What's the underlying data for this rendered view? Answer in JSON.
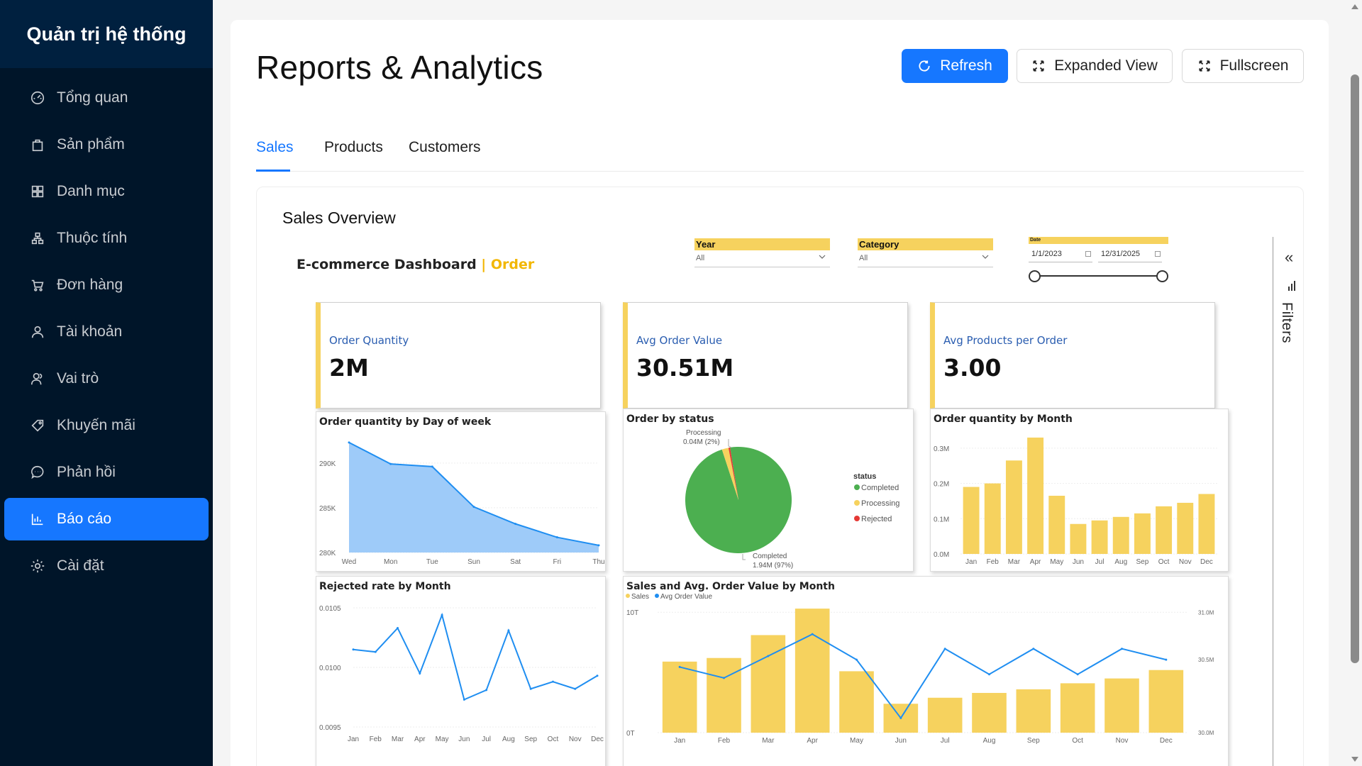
{
  "sidebar": {
    "brand": "Quản trị hệ thống",
    "items": [
      {
        "label": "Tổng quan",
        "icon": "dashboard-icon"
      },
      {
        "label": "Sản phẩm",
        "icon": "shopping-bag-icon"
      },
      {
        "label": "Danh mục",
        "icon": "grid-icon"
      },
      {
        "label": "Thuộc tính",
        "icon": "cluster-icon"
      },
      {
        "label": "Đơn hàng",
        "icon": "cart-icon"
      },
      {
        "label": "Tài khoản",
        "icon": "user-icon"
      },
      {
        "label": "Vai trò",
        "icon": "team-icon"
      },
      {
        "label": "Khuyến mãi",
        "icon": "tag-icon"
      },
      {
        "label": "Phản hồi",
        "icon": "message-icon"
      },
      {
        "label": "Báo cáo",
        "icon": "bar-chart-icon",
        "active": true
      },
      {
        "label": "Cài đặt",
        "icon": "gear-icon"
      }
    ]
  },
  "header": {
    "title": "Reports & Analytics",
    "refresh_label": "Refresh",
    "expanded_label": "Expanded View",
    "fullscreen_label": "Fullscreen"
  },
  "tabs": [
    {
      "label": "Sales",
      "active": true
    },
    {
      "label": "Products"
    },
    {
      "label": "Customers"
    }
  ],
  "overview": {
    "title": "Sales Overview",
    "dashboard_title": "E-commerce Dashboard",
    "dashboard_accent": "| Order",
    "slicers": {
      "year": {
        "label": "Year",
        "value": "All"
      },
      "category": {
        "label": "Category",
        "value": "All"
      },
      "date": {
        "label": "Date",
        "start": "1/1/2023",
        "end": "12/31/2025"
      }
    },
    "kpis": [
      {
        "label": "Order Quantity",
        "value": "2M"
      },
      {
        "label": "Avg Order Value",
        "value": "30.51M"
      },
      {
        "label": "Avg Products per Order",
        "value": "3.00"
      }
    ],
    "filters_label": "Filters",
    "accent_color": "#f6d25e"
  },
  "chart_data": [
    {
      "type": "area",
      "title": "Order quantity by Day of week",
      "categories": [
        "Wed",
        "Mon",
        "Tue",
        "Sun",
        "Sat",
        "Fri",
        "Thu"
      ],
      "values": [
        292300,
        289900,
        289600,
        285100,
        283200,
        281700,
        280800
      ],
      "ylim": [
        280000,
        293000
      ],
      "yticks": [
        "280K",
        "285K",
        "290K"
      ],
      "ytick_values": [
        280000,
        285000,
        290000
      ],
      "color": "#1f8ef1"
    },
    {
      "type": "pie",
      "title": "Order by status",
      "legend_title": "status",
      "legend": [
        "Completed",
        "Processing",
        "Rejected"
      ],
      "values": [
        1.94,
        0.04,
        0.01
      ],
      "colors": [
        "#4caf50",
        "#f6d25e",
        "#e53935"
      ],
      "labels": [
        {
          "line1": "Processing",
          "line2": "0.04M (2%)"
        },
        {
          "line1": "Completed",
          "line2": "1.94M (97%)"
        }
      ]
    },
    {
      "type": "bar",
      "title": "Order quantity by Month",
      "categories": [
        "Jan",
        "Feb",
        "Mar",
        "Apr",
        "May",
        "Jun",
        "Jul",
        "Aug",
        "Sep",
        "Oct",
        "Nov",
        "Dec"
      ],
      "values": [
        0.19,
        0.2,
        0.265,
        0.33,
        0.165,
        0.085,
        0.095,
        0.105,
        0.115,
        0.135,
        0.145,
        0.17
      ],
      "ylim": [
        0,
        0.35
      ],
      "yticks": [
        "0.0M",
        "0.1M",
        "0.2M",
        "0.3M"
      ],
      "ytick_values": [
        0,
        0.1,
        0.2,
        0.3
      ],
      "color": "#f6d25e"
    },
    {
      "type": "line",
      "title": "Rejected rate by Month",
      "categories": [
        "Jan",
        "Feb",
        "Mar",
        "Apr",
        "May",
        "Jun",
        "Jul",
        "Aug",
        "Sep",
        "Oct",
        "Nov",
        "Dec"
      ],
      "values": [
        0.01015,
        0.01013,
        0.01033,
        0.00995,
        0.01044,
        0.00973,
        0.00981,
        0.01031,
        0.00982,
        0.00988,
        0.00982,
        0.00993
      ],
      "ylim": [
        0.0095,
        0.0105
      ],
      "yticks": [
        "0.0095",
        "0.0100",
        "0.0105"
      ],
      "ytick_values": [
        0.0095,
        0.01,
        0.0105
      ],
      "color": "#1f8ef1"
    },
    {
      "type": "bar",
      "title": "Sales and Avg. Order Value by Month",
      "legend": [
        "Sales",
        "Avg Order Value"
      ],
      "categories": [
        "Jan",
        "Feb",
        "Mar",
        "Apr",
        "May",
        "Jun",
        "Jul",
        "Aug",
        "Sep",
        "Oct",
        "Nov",
        "Dec"
      ],
      "series": [
        {
          "name": "Sales",
          "values": [
            5.9,
            6.2,
            8.1,
            10.3,
            5.1,
            2.4,
            2.9,
            3.3,
            3.6,
            4.1,
            4.5,
            5.2
          ],
          "color": "#f6d25e"
        },
        {
          "name": "Avg Order Value",
          "values": [
            30.48,
            30.45,
            30.51,
            30.57,
            30.5,
            30.34,
            30.53,
            30.46,
            30.53,
            30.46,
            30.53,
            30.5
          ],
          "color": "#1f8ef1"
        }
      ],
      "ylim": [
        0,
        10.6
      ],
      "yticks": [
        "0T",
        "10T"
      ],
      "ytick_values": [
        0,
        10
      ],
      "y2lim": [
        30.3,
        30.65
      ],
      "y2ticks": [
        "30.0M",
        "30.5M",
        "31.0M"
      ],
      "y2tick_values": [
        30.3,
        30.5,
        30.63
      ]
    }
  ]
}
